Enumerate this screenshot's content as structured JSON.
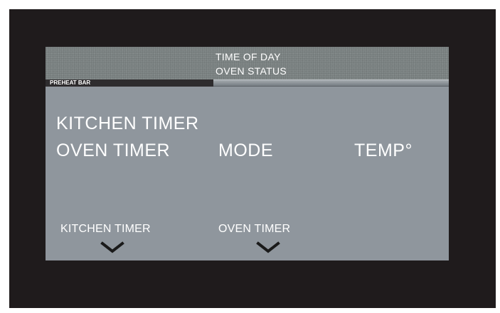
{
  "status": {
    "time_of_day": "TIME OF DAY",
    "oven_status": "OVEN STATUS",
    "preheat_bar_label": "PREHEAT BAR",
    "preheat_progress": 0
  },
  "main": {
    "kitchen_timer": "KITCHEN TIMER",
    "oven_timer": "OVEN TIMER",
    "mode": "MODE",
    "temp": "TEMP°"
  },
  "softkeys": {
    "kitchen_timer": "KITCHEN  TIMER",
    "oven_timer": "OVEN TIMER",
    "icons": [
      "chevron-down-icon",
      "chevron-down-icon"
    ]
  },
  "colors": {
    "bezel": "#1f1b1c",
    "screen": "#8f969d",
    "status_band": "#7f8686",
    "text": "#ffffff",
    "preheat_label_bg": "#2e2c2e"
  }
}
